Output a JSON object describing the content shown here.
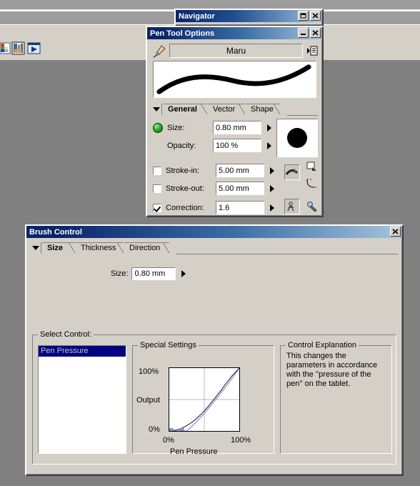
{
  "app": {
    "toolbar_icons": [
      "palette-icon",
      "layers-icon",
      "play-icon"
    ]
  },
  "navigator": {
    "title": "Navigator",
    "minimize_label": "_",
    "close_label": "x"
  },
  "pen_tool_options": {
    "title": "Pen Tool Options",
    "preset_name": "Maru",
    "preset_icon": "pen-nib-icon",
    "preset_menu_icon": "list-menu-icon",
    "stroke_preview_icon": "brush-stroke-preview",
    "tabs": [
      {
        "label": "General",
        "active": true
      },
      {
        "label": "Vector",
        "active": false
      },
      {
        "label": "Shape",
        "active": false
      }
    ],
    "fields": [
      {
        "label": "Size:",
        "value": "0.80 mm",
        "bullet": true,
        "checkbox": null
      },
      {
        "label": "Opacity:",
        "value": "100 %",
        "bullet": false,
        "checkbox": null
      },
      {
        "label": "Stroke-in:",
        "value": "5.00 mm",
        "bullet": false,
        "checkbox": false
      },
      {
        "label": "Stroke-out:",
        "value": "5.00 mm",
        "bullet": false,
        "checkbox": false
      },
      {
        "label": "Correction:",
        "value": "1.6",
        "bullet": false,
        "checkbox": true
      }
    ],
    "brush_thumbnail": "round-brush-tip",
    "side_icons": [
      "stroke-taper-icon",
      "corner-round-icon",
      "brush-angle-icon",
      "brush-settings-icon"
    ]
  },
  "brush_control": {
    "title": "Brush Control",
    "tabs": [
      {
        "label": "Size",
        "active": true
      },
      {
        "label": "Thickness",
        "active": false
      },
      {
        "label": "Direction",
        "active": false
      }
    ],
    "size_label": "Size:",
    "size_value": "0.80 mm",
    "select_control_label": "Select Control:",
    "control_list": [
      "Pen Pressure"
    ],
    "special_settings_label": "Special Settings",
    "control_explanation_label": "Control Explanation",
    "control_explanation_text": "This changes the parameters in accordance with the ''pressure of the pen'' on the tablet."
  },
  "chart_data": {
    "type": "line",
    "title": "Special Settings",
    "xlabel": "Pen Pressure",
    "ylabel": "Output",
    "xlim": [
      0,
      100
    ],
    "ylim": [
      0,
      100
    ],
    "xticks": [
      "0%",
      "100%"
    ],
    "yticks": [
      "0%",
      "100%"
    ],
    "grid": true,
    "legend": "none",
    "series": [
      {
        "name": "response-curve",
        "color": "#303048",
        "x": [
          0,
          5,
          10,
          15,
          20,
          25,
          30,
          35,
          40,
          45,
          50,
          55,
          60,
          65,
          70,
          75,
          80,
          85,
          90,
          95,
          100
        ],
        "y": [
          0,
          0.5,
          1.5,
          3,
          5.5,
          8.5,
          12,
          16,
          21,
          26,
          32,
          38,
          45,
          52,
          59,
          66,
          74,
          81,
          88,
          94,
          100
        ]
      },
      {
        "name": "input-curve",
        "color": "#8c8cc8",
        "x": [
          0,
          10,
          20,
          25,
          30,
          40,
          50,
          60,
          70,
          80,
          90,
          100
        ],
        "y": [
          0,
          0,
          0,
          0,
          5,
          16,
          28,
          41,
          55,
          69,
          84,
          100
        ]
      }
    ],
    "markers": [
      {
        "name": "min-handle",
        "x": 2,
        "y": 0,
        "color": "#8c8cc8"
      },
      {
        "name": "range-handle",
        "x": 17,
        "y": 0,
        "color": "#8c8cc8"
      }
    ]
  }
}
